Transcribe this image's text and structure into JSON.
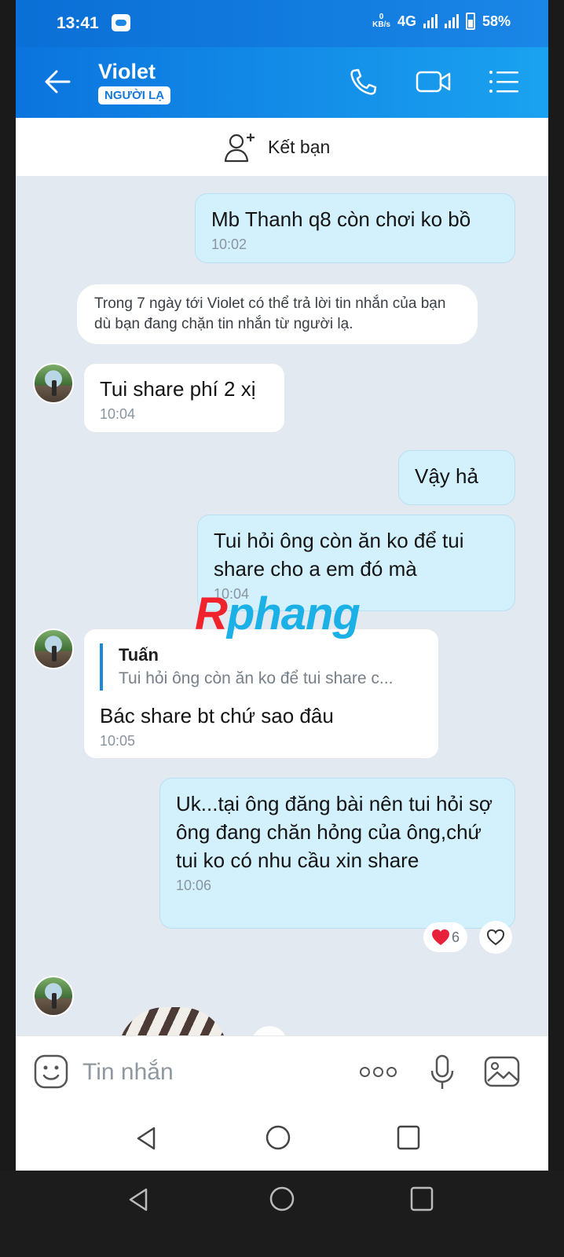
{
  "status_bar": {
    "time": "13:41",
    "speed_value": "0",
    "speed_unit": "KB/s",
    "network": "4G",
    "battery": "58%"
  },
  "header": {
    "contact_name": "Violet",
    "badge": "NGƯỜI LẠ",
    "icons": [
      "back-arrow-icon",
      "phone-icon",
      "video-camera-icon",
      "menu-list-icon"
    ]
  },
  "add_friend": {
    "label": "Kết bạn"
  },
  "messages": [
    {
      "direction": "out",
      "text": "Mb Thanh q8 còn chơi ko bồ",
      "time": "10:02"
    },
    {
      "direction": "in",
      "text": "Tui share phí 2 xị",
      "time": "10:04"
    },
    {
      "direction": "out",
      "text": "Vậy hả"
    },
    {
      "direction": "out",
      "text": "Tui hỏi ông còn ăn ko để tui share cho a em đó mà",
      "time": "10:04"
    },
    {
      "direction": "in",
      "reply_to": {
        "author": "Tuấn",
        "snippet": "Tui hỏi ông còn ăn ko để tui share c..."
      },
      "text": "Bác share bt chứ sao đâu",
      "time": "10:05"
    },
    {
      "direction": "out",
      "text": "Uk...tại ông đăng bài nên tui hỏi sợ ông đang chăn hỏng của ông,chứ tui ko có nhu cầu xin share",
      "time": "10:06",
      "reaction_count": "6"
    }
  ],
  "system_notice": "Trong 7 ngày tới Violet có thể trả lời tin nhắn của bạn dù bạn đang chặn tin nhắn từ người lạ.",
  "watermark": {
    "part1": "R",
    "part2": "phang"
  },
  "input": {
    "placeholder": "Tin nhắn"
  },
  "colors": {
    "header": "#0b74de",
    "outgoing_bubble": "#d3f1fd",
    "chat_background": "#e2e9f1",
    "heart": "#e8213a"
  }
}
